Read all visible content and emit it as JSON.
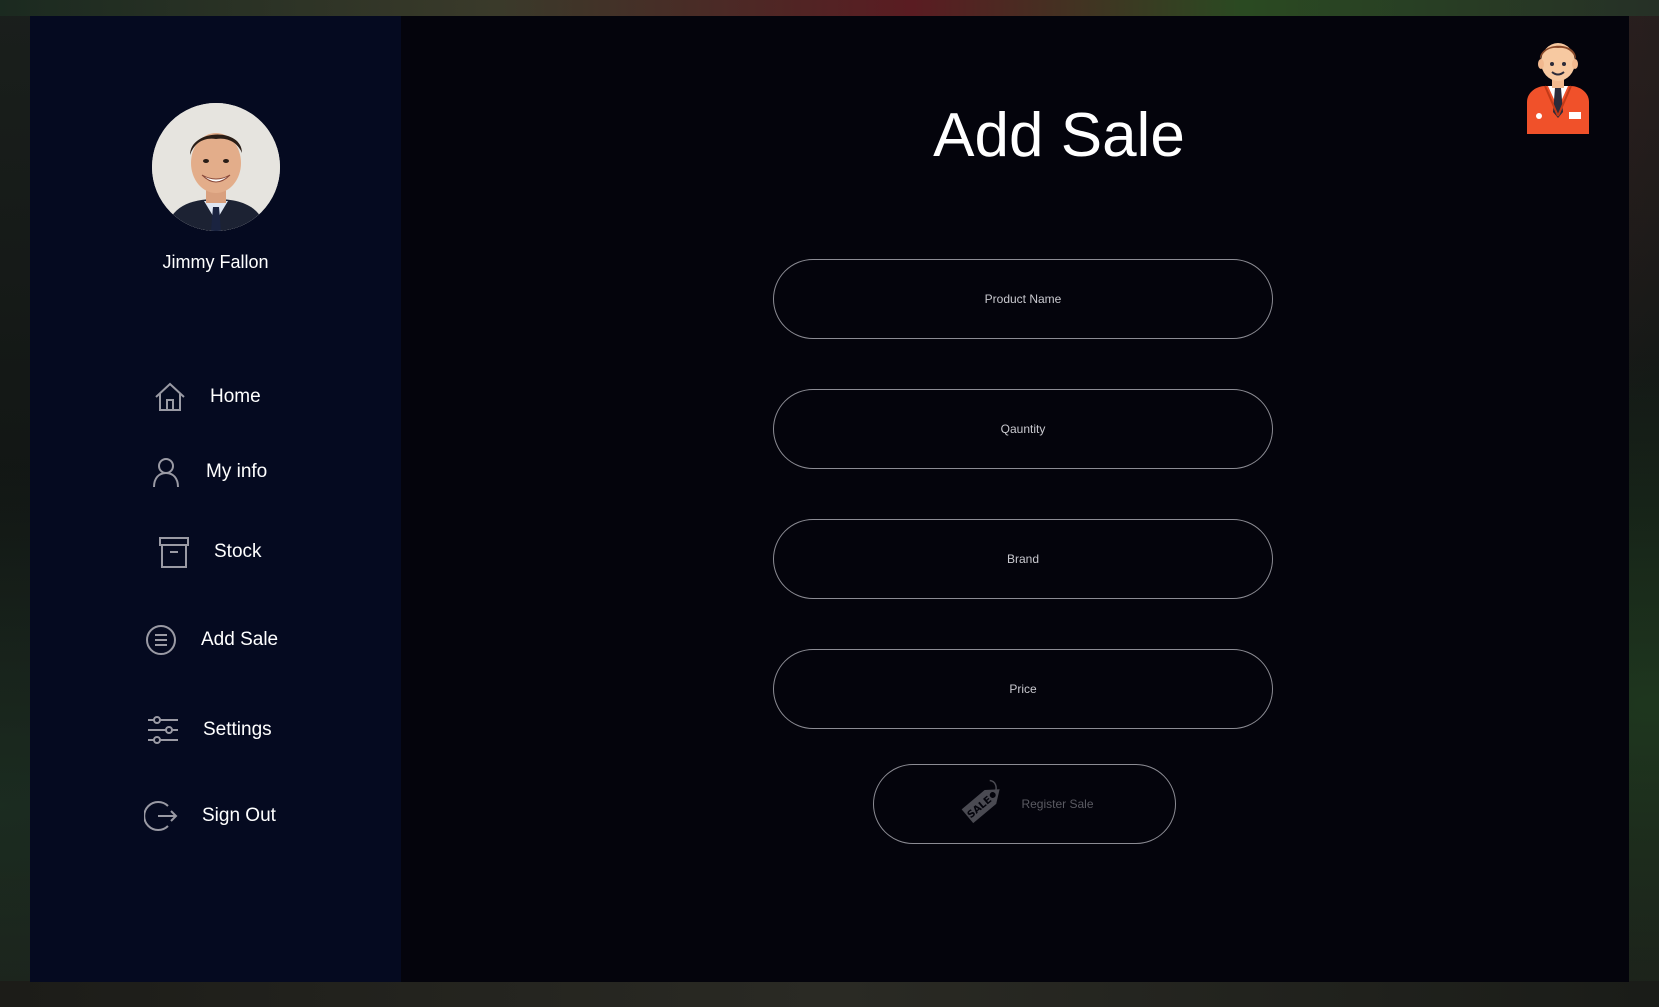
{
  "user": {
    "name": "Jimmy Fallon",
    "avatar_icon": "profile-photo"
  },
  "sidebar": {
    "items": [
      {
        "label": "Home",
        "icon": "home-icon"
      },
      {
        "label": "My info",
        "icon": "user-icon"
      },
      {
        "label": "Stock",
        "icon": "archive-box-icon"
      },
      {
        "label": "Add Sale",
        "icon": "list-circle-icon"
      },
      {
        "label": "Settings",
        "icon": "sliders-icon"
      },
      {
        "label": "Sign Out",
        "icon": "sign-out-icon"
      }
    ]
  },
  "main": {
    "title": "Add Sale",
    "fields": {
      "product_name": {
        "placeholder": "Product Name",
        "value": ""
      },
      "quantity": {
        "placeholder": "Qauntity",
        "value": ""
      },
      "brand": {
        "placeholder": "Brand",
        "value": ""
      },
      "price": {
        "placeholder": "Price",
        "value": ""
      }
    },
    "register_button": {
      "label": "Register Sale",
      "icon": "sale-tag-icon",
      "tag_text": "SALE"
    },
    "mascot_icon": "salesman-icon"
  },
  "colors": {
    "sidebar_bg": "#050a20",
    "main_bg": "#04040c",
    "field_border": "#8c8c94",
    "text": "#ffffff",
    "mascot_accent": "#f0512a"
  }
}
